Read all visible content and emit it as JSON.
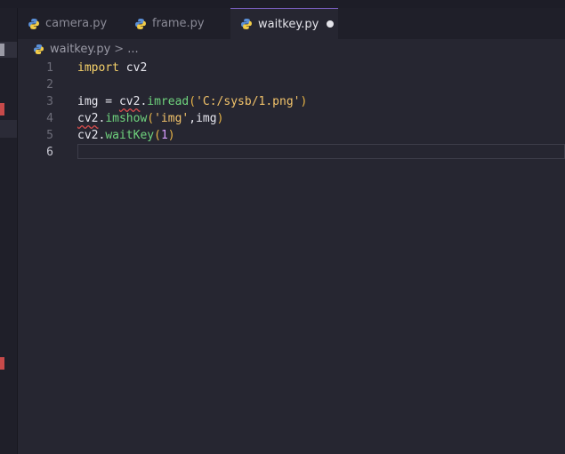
{
  "tabs": [
    {
      "label": "camera.py",
      "icon": "python-icon",
      "active": false
    },
    {
      "label": "frame.py",
      "icon": "python-icon",
      "active": false
    },
    {
      "label": "waitkey.py",
      "icon": "python-icon",
      "active": true,
      "unsaved": true
    }
  ],
  "breadcrumb": {
    "file": "waitkey.py",
    "separator": ">",
    "more": "..."
  },
  "editor": {
    "line_numbers": [
      "1",
      "2",
      "3",
      "4",
      "5",
      "6"
    ],
    "lines": [
      {
        "tokens": [
          {
            "t": "import",
            "c": "kw"
          },
          {
            "t": " cv2",
            "c": ""
          }
        ]
      },
      {
        "tokens": []
      },
      {
        "tokens": [
          {
            "t": "img = ",
            "c": ""
          },
          {
            "t": "cv2",
            "c": "sq"
          },
          {
            "t": ".",
            "c": ""
          },
          {
            "t": "imread",
            "c": "fn"
          },
          {
            "t": "(",
            "c": "paren"
          },
          {
            "t": "'C:/sysb/1.png'",
            "c": "str"
          },
          {
            "t": ")",
            "c": "paren"
          }
        ]
      },
      {
        "tokens": [
          {
            "t": "cv2",
            "c": "sq"
          },
          {
            "t": ".",
            "c": ""
          },
          {
            "t": "imshow",
            "c": "fn"
          },
          {
            "t": "(",
            "c": "paren"
          },
          {
            "t": "'img'",
            "c": "str"
          },
          {
            "t": ",img",
            "c": ""
          },
          {
            "t": ")",
            "c": "paren"
          }
        ]
      },
      {
        "tokens": [
          {
            "t": "cv2",
            "c": ""
          },
          {
            "t": ".",
            "c": ""
          },
          {
            "t": "waitKey",
            "c": "fn"
          },
          {
            "t": "(",
            "c": "paren"
          },
          {
            "t": "1",
            "c": "num-lit"
          },
          {
            "t": ")",
            "c": "paren"
          }
        ]
      },
      {
        "tokens": []
      }
    ],
    "active_line": 6
  },
  "colors": {
    "background": "#262631",
    "tab_active_border": "#7a5fc0",
    "keyword": "#f7d26a",
    "function": "#6fd37d",
    "string": "#f2c36a",
    "error_squiggle": "#d24b4b"
  }
}
